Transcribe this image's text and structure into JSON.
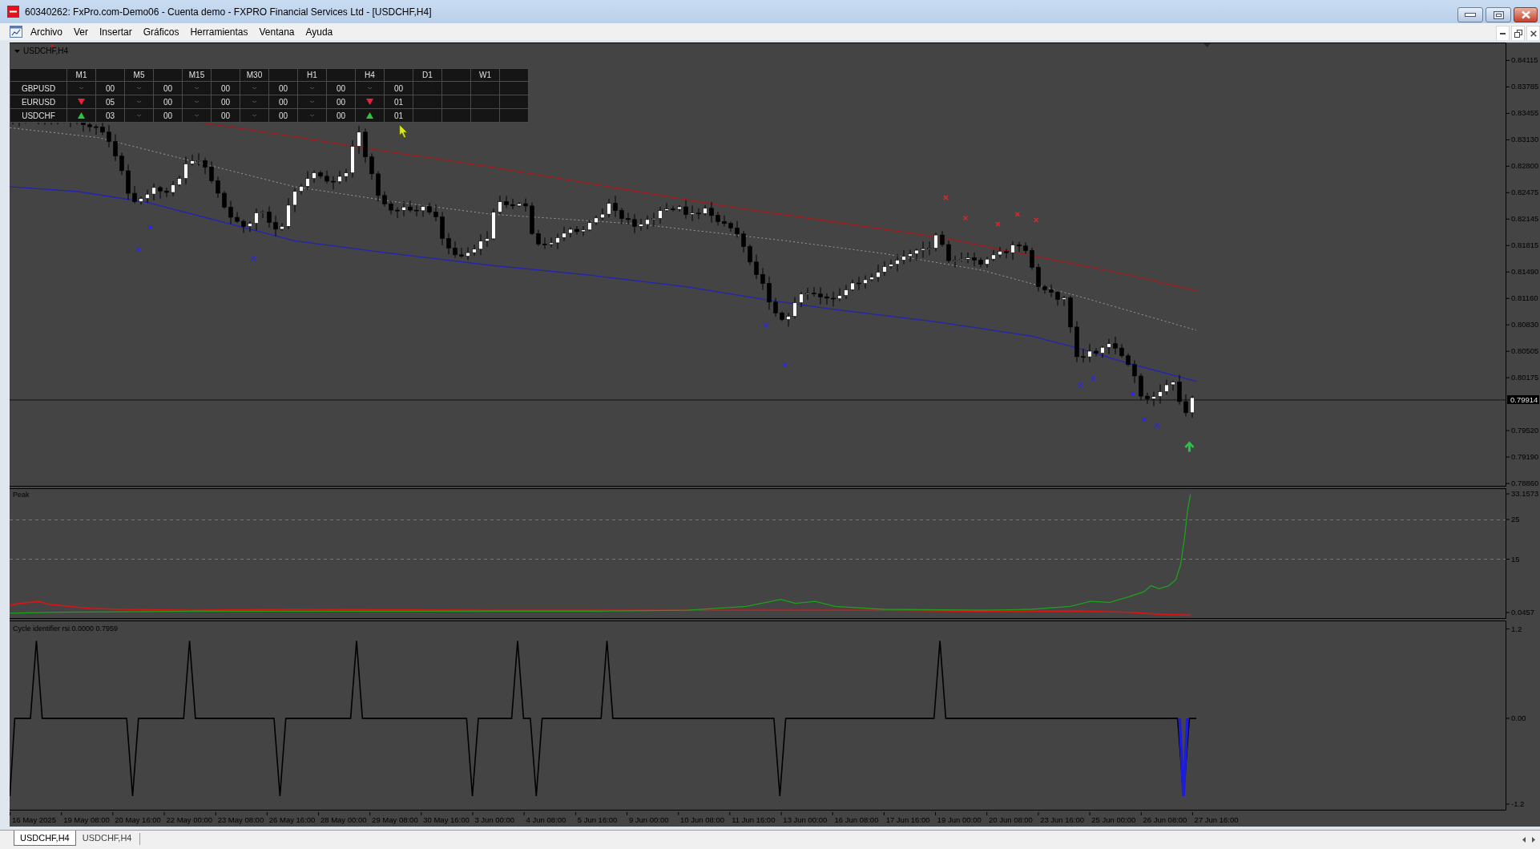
{
  "window": {
    "title": "60340262: FxPro.com-Demo06 - Cuenta demo - FXPRO Financial Services Ltd - [USDCHF,H4]"
  },
  "menu": [
    "Archivo",
    "Ver",
    "Insertar",
    "Gráficos",
    "Herramientas",
    "Ventana",
    "Ayuda"
  ],
  "chart": {
    "title": "USDCHF,H4",
    "signal_table": {
      "columns": [
        "M1",
        "M5",
        "M15",
        "M30",
        "H1",
        "H4",
        "D1",
        "W1"
      ],
      "rows": [
        {
          "symbol": "GBPUSD",
          "cells": [
            {
              "kind": "flat",
              "count": "00"
            },
            {
              "kind": "flat",
              "count": "00"
            },
            {
              "kind": "flat",
              "count": "00"
            },
            {
              "kind": "flat",
              "count": "00"
            },
            {
              "kind": "flat",
              "count": "00"
            },
            {
              "kind": "flat",
              "count": "00"
            }
          ]
        },
        {
          "symbol": "EURUSD",
          "cells": [
            {
              "kind": "down",
              "count": "05"
            },
            {
              "kind": "flat",
              "count": "00"
            },
            {
              "kind": "flat",
              "count": "00"
            },
            {
              "kind": "flat",
              "count": "00"
            },
            {
              "kind": "flat",
              "count": "00"
            },
            {
              "kind": "down",
              "count": "01"
            }
          ]
        },
        {
          "symbol": "USDCHF",
          "cells": [
            {
              "kind": "up",
              "count": "03"
            },
            {
              "kind": "flat",
              "count": "00"
            },
            {
              "kind": "flat",
              "count": "00"
            },
            {
              "kind": "flat",
              "count": "00"
            },
            {
              "kind": "flat",
              "count": "00"
            },
            {
              "kind": "up",
              "count": "01"
            }
          ]
        }
      ]
    },
    "price_axis": [
      {
        "label": "0.84115",
        "kind": "tick"
      },
      {
        "label": "0.83785",
        "kind": "tick"
      },
      {
        "label": "0.83455",
        "kind": "tick"
      },
      {
        "label": "0.83130",
        "kind": "tick"
      },
      {
        "label": "0.82800",
        "kind": "tick"
      },
      {
        "label": "0.82475",
        "kind": "tick"
      },
      {
        "label": "0.82145",
        "kind": "tick"
      },
      {
        "label": "0.81815",
        "kind": "tick"
      },
      {
        "label": "0.81490",
        "kind": "tick"
      },
      {
        "label": "0.81160",
        "kind": "tick"
      },
      {
        "label": "0.80830",
        "kind": "tick"
      },
      {
        "label": "0.80505",
        "kind": "tick"
      },
      {
        "label": "0.80175",
        "kind": "tick"
      },
      {
        "label": "0.79914",
        "kind": "current"
      },
      {
        "label": "0.79520",
        "kind": "tick"
      },
      {
        "label": "0.79190",
        "kind": "tick"
      },
      {
        "label": "0.78860",
        "kind": "tick"
      }
    ],
    "indicators": [
      {
        "kind": "peak",
        "title": "Peak",
        "axis": [
          "33.1573",
          "25",
          "15",
          "0.0457"
        ]
      },
      {
        "kind": "cycle",
        "title": "Cycle identifier rsi 0.0000 0.7959",
        "axis": [
          "1.2",
          "0.00",
          "-1.2"
        ]
      }
    ],
    "time_axis": [
      "16 May 2025",
      "19 May 08:00",
      "20 May 16:00",
      "22 May 00:00",
      "23 May 08:00",
      "26 May 16:00",
      "28 May 00:00",
      "29 May 08:00",
      "30 May 16:00",
      "3 Jun 00:00",
      "4 Jun 08:00",
      "5 Jun 16:00",
      "9 Jun 00:00",
      "10 Jun 08:00",
      "11 Jun 16:00",
      "13 Jun 00:00",
      "16 Jun 08:00",
      "17 Jun 16:00",
      "19 Jun 00:00",
      "20 Jun 08:00",
      "23 Jun 16:00",
      "25 Jun 00:00",
      "26 Jun 08:00",
      "27 Jun 16:00"
    ]
  },
  "tabs": [
    {
      "label": "USDCHF,H4",
      "selected": true
    },
    {
      "label": "USDCHF,H4",
      "selected": false
    }
  ]
}
